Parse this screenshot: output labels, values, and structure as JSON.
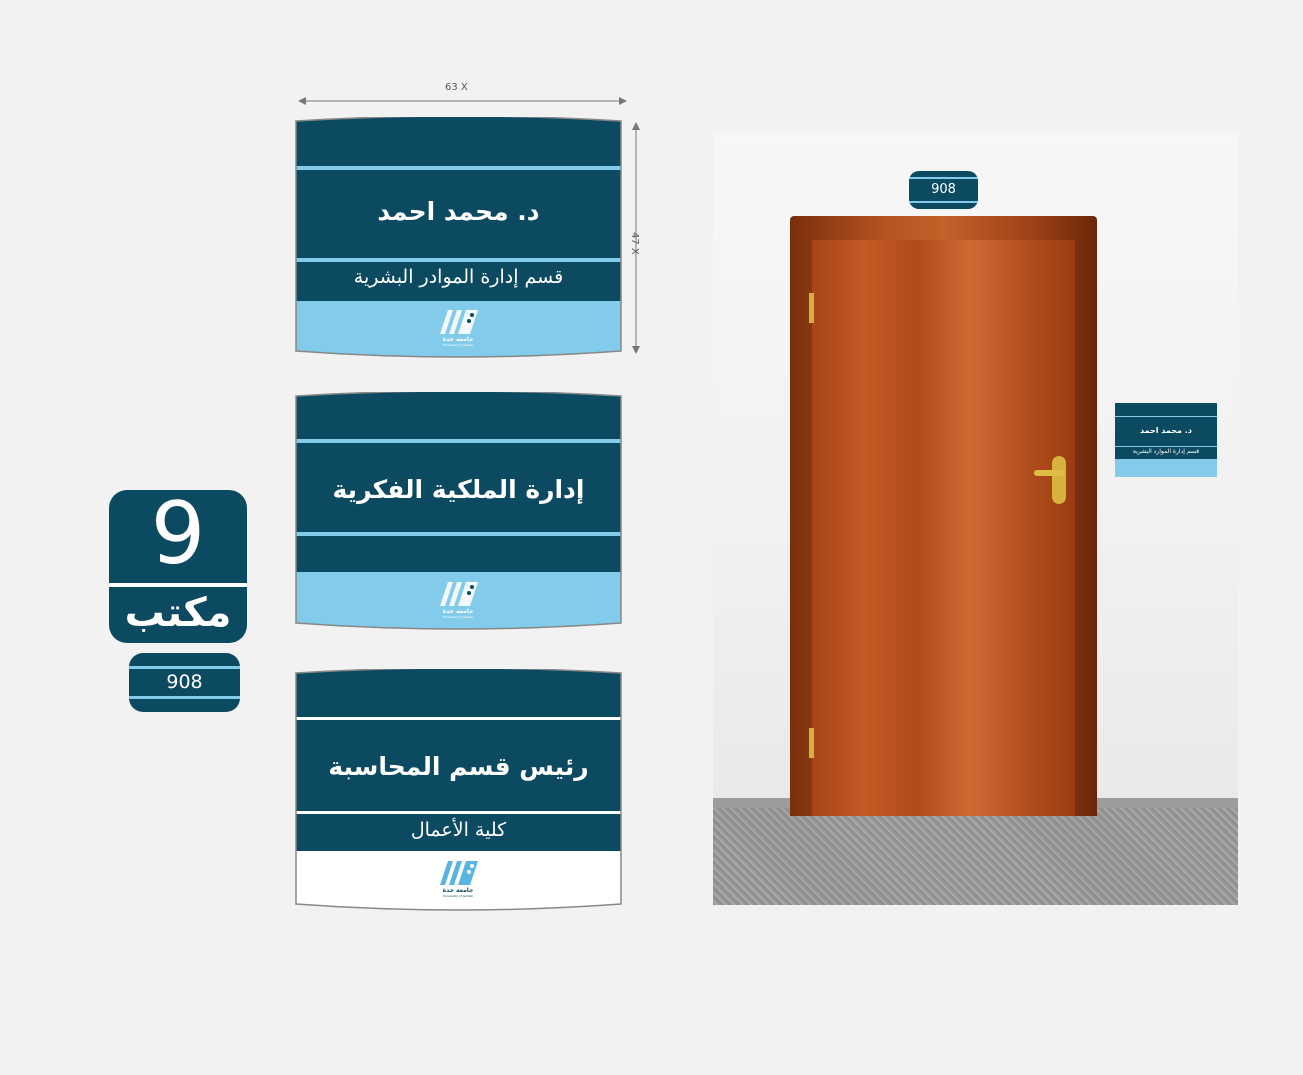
{
  "dimensions": {
    "width_label": "63 X",
    "height_label": "47 X"
  },
  "signs": [
    {
      "name": "د. محمد احمد",
      "department": "قسم إدارة الموادر البشرية",
      "logo_ar": "جامعة جدة",
      "logo_en": "University of Jeddah"
    },
    {
      "name": "إدارة الملكية الفكرية",
      "logo_ar": "جامعة جدة",
      "logo_en": "University of Jeddah"
    },
    {
      "name": "رئيس قسم المحاسبة",
      "department": "كلية الأعمال",
      "logo_ar": "جامعة جدة",
      "logo_en": "University of Jeddah"
    }
  ],
  "office_badge": {
    "number": "9",
    "label": "مكتب",
    "room": "908"
  },
  "photo": {
    "room_plate": "908",
    "door_sign_name": "د. محمد احمد",
    "door_sign_department": "قسم إدارة الموارد البشرية"
  },
  "colors": {
    "navy": "#0b4a60",
    "light_blue": "#82cbea",
    "background": "#f2f2f2"
  }
}
